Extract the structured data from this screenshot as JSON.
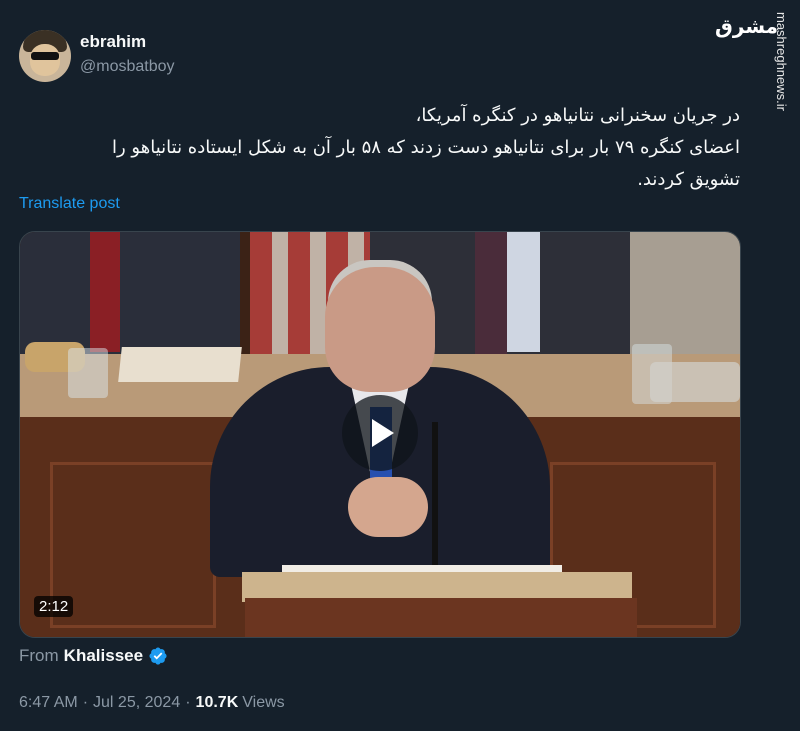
{
  "author": {
    "display_name": "ebrahim",
    "handle": "@mosbatboy"
  },
  "post": {
    "text_lines": [
      "در جریان سخنرانی نتانیاهو در کنگره آمریکا،",
      "اعضای کنگره ۷۹ بار برای نتانیاهو دست زدند که ۵۸ بار آن به شکل ایستاده نتانیاهو را",
      "تشویق کردند."
    ],
    "translate_label": "Translate post"
  },
  "media": {
    "duration": "2:12",
    "play_icon": "play-icon"
  },
  "attribution": {
    "from_label": "From",
    "from_name": "Khalissee",
    "verified_icon": "verified-badge-icon"
  },
  "meta": {
    "time": "6:47 AM",
    "separator": "·",
    "date": "Jul 25, 2024",
    "views_count": "10.7K",
    "views_label": "Views"
  },
  "watermark": {
    "logo_text": "مشرق",
    "url": "mashreghnews.ir"
  },
  "colors": {
    "background": "#15202b",
    "link": "#1d9bf0",
    "secondary_text": "#8b98a5",
    "verified": "#1d9bf0"
  }
}
